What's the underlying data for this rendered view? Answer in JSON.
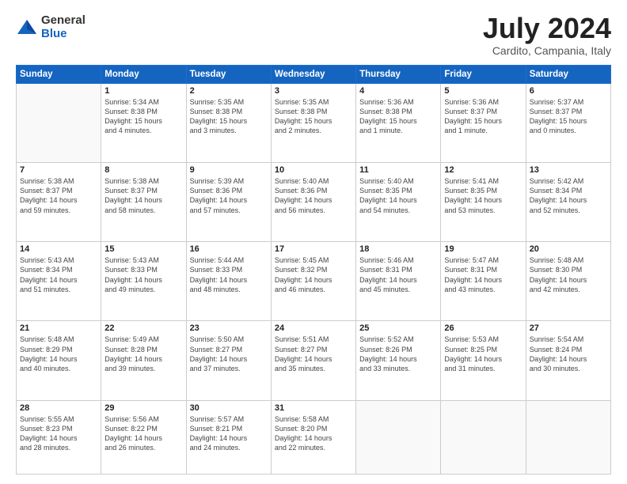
{
  "logo": {
    "general": "General",
    "blue": "Blue"
  },
  "header": {
    "month": "July 2024",
    "location": "Cardito, Campania, Italy"
  },
  "weekdays": [
    "Sunday",
    "Monday",
    "Tuesday",
    "Wednesday",
    "Thursday",
    "Friday",
    "Saturday"
  ],
  "weeks": [
    [
      {
        "day": "",
        "info": ""
      },
      {
        "day": "1",
        "info": "Sunrise: 5:34 AM\nSunset: 8:38 PM\nDaylight: 15 hours\nand 4 minutes."
      },
      {
        "day": "2",
        "info": "Sunrise: 5:35 AM\nSunset: 8:38 PM\nDaylight: 15 hours\nand 3 minutes."
      },
      {
        "day": "3",
        "info": "Sunrise: 5:35 AM\nSunset: 8:38 PM\nDaylight: 15 hours\nand 2 minutes."
      },
      {
        "day": "4",
        "info": "Sunrise: 5:36 AM\nSunset: 8:38 PM\nDaylight: 15 hours\nand 1 minute."
      },
      {
        "day": "5",
        "info": "Sunrise: 5:36 AM\nSunset: 8:37 PM\nDaylight: 15 hours\nand 1 minute."
      },
      {
        "day": "6",
        "info": "Sunrise: 5:37 AM\nSunset: 8:37 PM\nDaylight: 15 hours\nand 0 minutes."
      }
    ],
    [
      {
        "day": "7",
        "info": "Sunrise: 5:38 AM\nSunset: 8:37 PM\nDaylight: 14 hours\nand 59 minutes."
      },
      {
        "day": "8",
        "info": "Sunrise: 5:38 AM\nSunset: 8:37 PM\nDaylight: 14 hours\nand 58 minutes."
      },
      {
        "day": "9",
        "info": "Sunrise: 5:39 AM\nSunset: 8:36 PM\nDaylight: 14 hours\nand 57 minutes."
      },
      {
        "day": "10",
        "info": "Sunrise: 5:40 AM\nSunset: 8:36 PM\nDaylight: 14 hours\nand 56 minutes."
      },
      {
        "day": "11",
        "info": "Sunrise: 5:40 AM\nSunset: 8:35 PM\nDaylight: 14 hours\nand 54 minutes."
      },
      {
        "day": "12",
        "info": "Sunrise: 5:41 AM\nSunset: 8:35 PM\nDaylight: 14 hours\nand 53 minutes."
      },
      {
        "day": "13",
        "info": "Sunrise: 5:42 AM\nSunset: 8:34 PM\nDaylight: 14 hours\nand 52 minutes."
      }
    ],
    [
      {
        "day": "14",
        "info": "Sunrise: 5:43 AM\nSunset: 8:34 PM\nDaylight: 14 hours\nand 51 minutes."
      },
      {
        "day": "15",
        "info": "Sunrise: 5:43 AM\nSunset: 8:33 PM\nDaylight: 14 hours\nand 49 minutes."
      },
      {
        "day": "16",
        "info": "Sunrise: 5:44 AM\nSunset: 8:33 PM\nDaylight: 14 hours\nand 48 minutes."
      },
      {
        "day": "17",
        "info": "Sunrise: 5:45 AM\nSunset: 8:32 PM\nDaylight: 14 hours\nand 46 minutes."
      },
      {
        "day": "18",
        "info": "Sunrise: 5:46 AM\nSunset: 8:31 PM\nDaylight: 14 hours\nand 45 minutes."
      },
      {
        "day": "19",
        "info": "Sunrise: 5:47 AM\nSunset: 8:31 PM\nDaylight: 14 hours\nand 43 minutes."
      },
      {
        "day": "20",
        "info": "Sunrise: 5:48 AM\nSunset: 8:30 PM\nDaylight: 14 hours\nand 42 minutes."
      }
    ],
    [
      {
        "day": "21",
        "info": "Sunrise: 5:48 AM\nSunset: 8:29 PM\nDaylight: 14 hours\nand 40 minutes."
      },
      {
        "day": "22",
        "info": "Sunrise: 5:49 AM\nSunset: 8:28 PM\nDaylight: 14 hours\nand 39 minutes."
      },
      {
        "day": "23",
        "info": "Sunrise: 5:50 AM\nSunset: 8:27 PM\nDaylight: 14 hours\nand 37 minutes."
      },
      {
        "day": "24",
        "info": "Sunrise: 5:51 AM\nSunset: 8:27 PM\nDaylight: 14 hours\nand 35 minutes."
      },
      {
        "day": "25",
        "info": "Sunrise: 5:52 AM\nSunset: 8:26 PM\nDaylight: 14 hours\nand 33 minutes."
      },
      {
        "day": "26",
        "info": "Sunrise: 5:53 AM\nSunset: 8:25 PM\nDaylight: 14 hours\nand 31 minutes."
      },
      {
        "day": "27",
        "info": "Sunrise: 5:54 AM\nSunset: 8:24 PM\nDaylight: 14 hours\nand 30 minutes."
      }
    ],
    [
      {
        "day": "28",
        "info": "Sunrise: 5:55 AM\nSunset: 8:23 PM\nDaylight: 14 hours\nand 28 minutes."
      },
      {
        "day": "29",
        "info": "Sunrise: 5:56 AM\nSunset: 8:22 PM\nDaylight: 14 hours\nand 26 minutes."
      },
      {
        "day": "30",
        "info": "Sunrise: 5:57 AM\nSunset: 8:21 PM\nDaylight: 14 hours\nand 24 minutes."
      },
      {
        "day": "31",
        "info": "Sunrise: 5:58 AM\nSunset: 8:20 PM\nDaylight: 14 hours\nand 22 minutes."
      },
      {
        "day": "",
        "info": ""
      },
      {
        "day": "",
        "info": ""
      },
      {
        "day": "",
        "info": ""
      }
    ]
  ]
}
